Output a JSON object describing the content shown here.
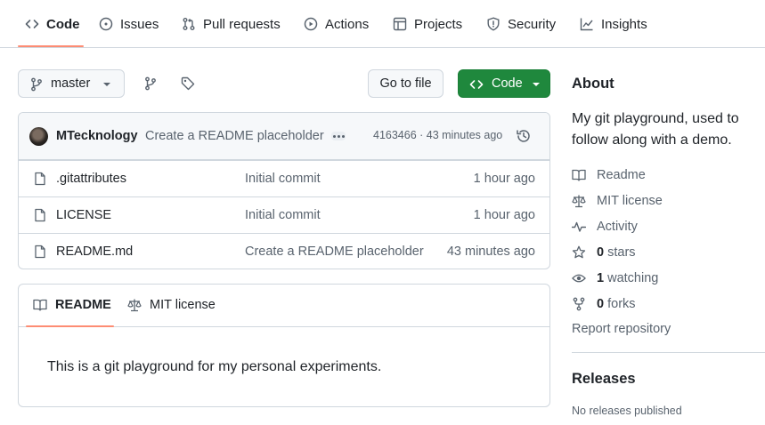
{
  "nav": {
    "tabs": [
      {
        "label": "Code",
        "icon": "code-icon"
      },
      {
        "label": "Issues",
        "icon": "issue-icon"
      },
      {
        "label": "Pull requests",
        "icon": "pull-request-icon"
      },
      {
        "label": "Actions",
        "icon": "play-icon"
      },
      {
        "label": "Projects",
        "icon": "table-icon"
      },
      {
        "label": "Security",
        "icon": "shield-icon"
      },
      {
        "label": "Insights",
        "icon": "graph-icon"
      }
    ]
  },
  "branch": {
    "name": "master",
    "go_to_file": "Go to file",
    "code_button": "Code"
  },
  "latest_commit": {
    "author": "MTecknology",
    "message": "Create a README placeholder",
    "meta": "4163466 · 43 minutes ago"
  },
  "files": [
    {
      "name": ".gitattributes",
      "message": "Initial commit",
      "age": "1 hour ago"
    },
    {
      "name": "LICENSE",
      "message": "Initial commit",
      "age": "1 hour ago"
    },
    {
      "name": "README.md",
      "message": "Create a README placeholder",
      "age": "43 minutes ago"
    }
  ],
  "readme": {
    "tabs": [
      "README",
      "MIT license"
    ],
    "body": "This is a git playground for my personal experiments."
  },
  "about": {
    "title": "About",
    "description": "My git playground, used to follow along with a demo.",
    "readme": "Readme",
    "license": "MIT license",
    "activity": "Activity",
    "stars_count": "0",
    "stars_label": "stars",
    "watching_count": "1",
    "watching_label": "watching",
    "forks_count": "0",
    "forks_label": "forks",
    "report": "Report repository"
  },
  "releases": {
    "title": "Releases",
    "empty": "No releases published"
  },
  "colors": {
    "accent_underline": "#fd8c73",
    "code_button": "#1f883d",
    "border": "#d0d7de",
    "muted_text": "#59636e"
  }
}
